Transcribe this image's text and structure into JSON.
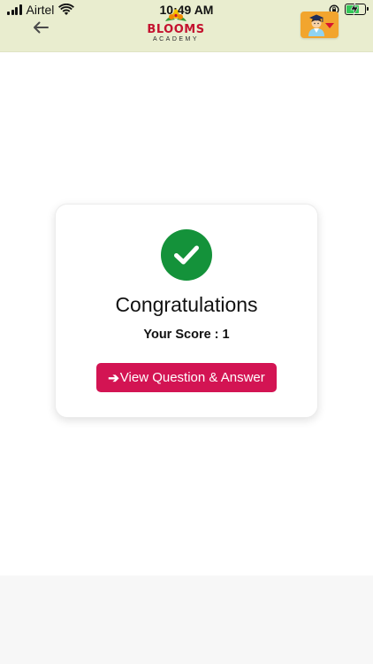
{
  "status_bar": {
    "carrier": "Airtel",
    "time": "10:49 AM"
  },
  "app_bar": {
    "logo_line1": "BLOOMS",
    "logo_line2": "ACADEMY"
  },
  "result_card": {
    "title": "Congratulations",
    "score_text": "Your Score : 1",
    "button_arrow": "➔",
    "button_label": "View Question & Answer"
  },
  "colors": {
    "header_bg": "#e9edcf",
    "success_green": "#14923a",
    "button_pink": "#d31453",
    "profile_orange": "#f2a52e",
    "logo_red": "#c4122f"
  },
  "icons": {
    "back": "arrow-left-icon",
    "success": "check-icon",
    "profile": "student-avatar-icon",
    "dropdown": "caret-down-icon"
  },
  "battery_level": 0.7
}
